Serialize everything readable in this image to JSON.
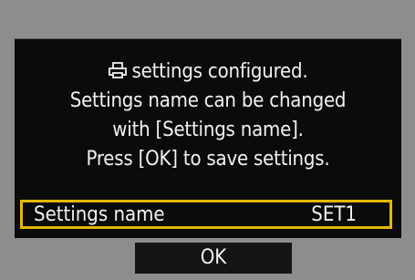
{
  "dialog": {
    "line1_text": "settings configured.",
    "line2": "Settings name can be changed",
    "line3": "with [Settings name].",
    "line4": "Press [OK] to save settings.",
    "icon": "printer-icon"
  },
  "settings_name_row": {
    "label": "Settings name",
    "value": "SET1"
  },
  "buttons": {
    "ok_label": "OK"
  },
  "colors": {
    "background": "#8d8d8d",
    "dialog_background": "#0b0b0b",
    "highlight_border": "#e6b800",
    "text": "#f2f2f2"
  }
}
